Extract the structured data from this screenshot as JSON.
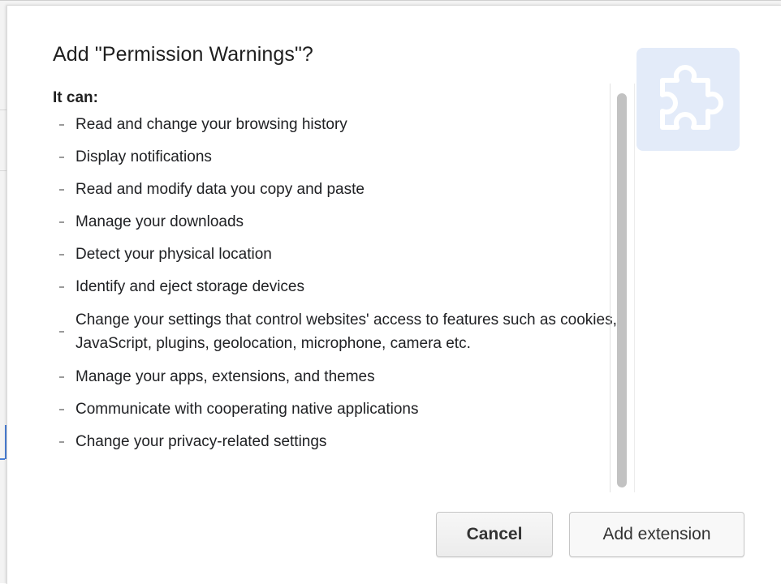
{
  "dialog": {
    "title": "Add \"Permission Warnings\"?",
    "subtitle": "It can:",
    "permissions": [
      "Read and change your browsing history",
      "Display notifications",
      "Read and modify data you copy and paste",
      "Manage your downloads",
      "Detect your physical location",
      "Identify and eject storage devices",
      "Change your settings that control websites' access to features such as cookies, JavaScript, plugins, geolocation, microphone, camera etc.",
      "Manage your apps, extensions, and themes",
      "Communicate with cooperating native applications",
      "Change your privacy-related settings"
    ],
    "icon": "puzzle-piece-icon",
    "buttons": {
      "cancel": "Cancel",
      "add": "Add extension"
    }
  },
  "colors": {
    "icon_bg": "#e3ebf9",
    "icon_stroke": "#ffffff",
    "bullet": "#9a9a9a",
    "scroll_thumb": "#c2c2c2"
  }
}
